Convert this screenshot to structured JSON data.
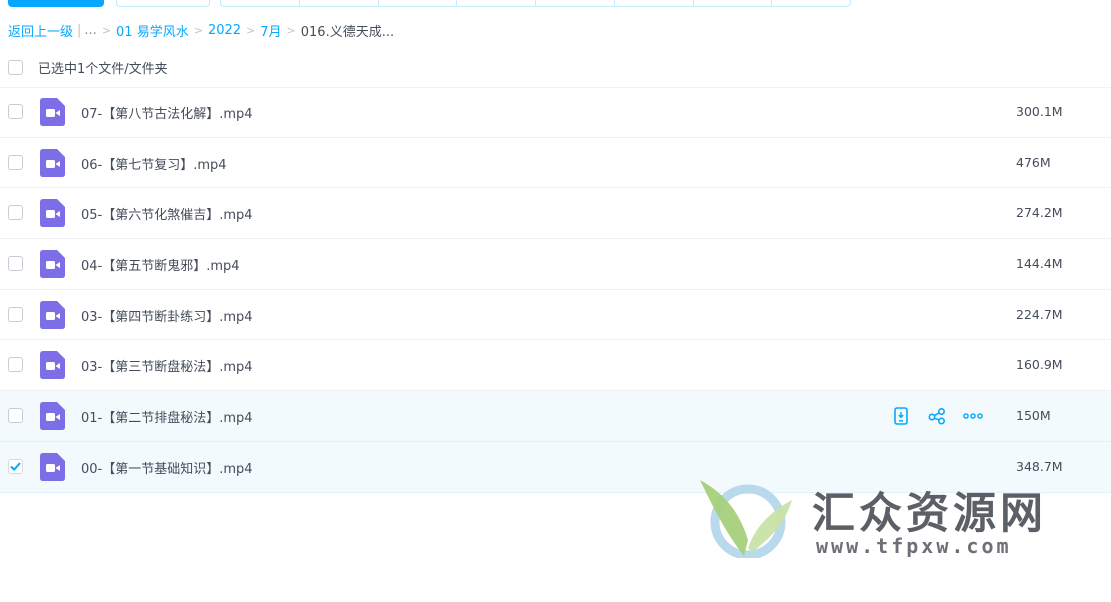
{
  "breadcrumb": {
    "back_label": "返回上一级",
    "bar": "|",
    "ellipsis": "...",
    "sep": ">",
    "items": [
      "01 易学风水",
      "2022",
      "7月"
    ],
    "current": "016.义德天成..."
  },
  "selection": {
    "label": "已选中1个文件/文件夹"
  },
  "files": [
    {
      "name": "07-【第八节古法化解】.mp4",
      "size": "300.1M",
      "checked": false
    },
    {
      "name": "06-【第七节复习】.mp4",
      "size": "476M",
      "checked": false
    },
    {
      "name": "05-【第六节化煞催吉】.mp4",
      "size": "274.2M",
      "checked": false
    },
    {
      "name": "04-【第五节断鬼邪】.mp4",
      "size": "144.4M",
      "checked": false
    },
    {
      "name": "03-【第四节断卦练习】.mp4",
      "size": "224.7M",
      "checked": false
    },
    {
      "name": "03-【第三节断盘秘法】.mp4",
      "size": "160.9M",
      "checked": false
    },
    {
      "name": "01-【第二节排盘秘法】.mp4",
      "size": "150M",
      "checked": false
    },
    {
      "name": "00-【第一节基础知识】.mp4",
      "size": "348.7M",
      "checked": true
    }
  ],
  "row_actions": [
    "phone-download-icon",
    "share-icon",
    "more-icon"
  ],
  "watermark": {
    "title": "汇众资源网",
    "url": "www.tfpxw.com"
  },
  "colors": {
    "accent": "#06a7ff",
    "video_icon": "#7c6ee6",
    "selected_row": "#f2fafe"
  }
}
